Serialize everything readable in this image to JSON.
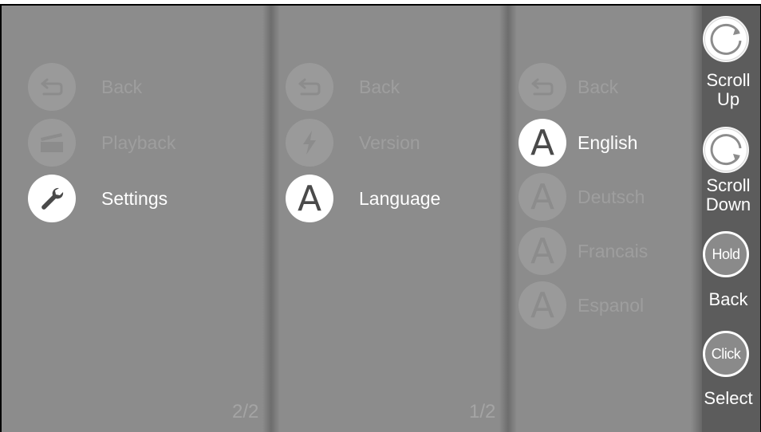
{
  "panels": {
    "main_menu": {
      "items": [
        {
          "label": "Back",
          "icon": "back-arrow-icon",
          "active": false
        },
        {
          "label": "Playback",
          "icon": "clapperboard-icon",
          "active": false
        },
        {
          "label": "Settings",
          "icon": "wrench-icon",
          "active": true
        }
      ],
      "page": "2/2"
    },
    "settings_menu": {
      "items": [
        {
          "label": "Back",
          "icon": "back-arrow-icon",
          "active": false
        },
        {
          "label": "Version",
          "icon": "lightning-icon",
          "active": false
        },
        {
          "label": "Language",
          "icon": "letter-a-icon",
          "icon_text": "A",
          "active": true
        }
      ],
      "page": "1/2"
    },
    "language_menu": {
      "items": [
        {
          "label": "Back",
          "icon": "back-arrow-icon",
          "active": false
        },
        {
          "label": "English",
          "icon": "letter-a-icon",
          "icon_text": "A",
          "active": true
        },
        {
          "label": "Deutsch",
          "icon": "letter-a-icon",
          "icon_text": "A",
          "active": false
        },
        {
          "label": "Francais",
          "icon": "letter-a-icon",
          "icon_text": "A",
          "active": false
        },
        {
          "label": "Espanol",
          "icon": "letter-a-icon",
          "icon_text": "A",
          "active": false
        }
      ]
    }
  },
  "controls": {
    "scroll_up": {
      "label_line1": "Scroll",
      "label_line2": "Up",
      "icon": "rotate-counterclockwise-icon"
    },
    "scroll_down": {
      "label_line1": "Scroll",
      "label_line2": "Down",
      "icon": "rotate-clockwise-icon"
    },
    "back": {
      "button_text": "Hold",
      "label": "Back"
    },
    "select": {
      "button_text": "Click",
      "label": "Select"
    }
  },
  "colors": {
    "background": "#8c8c8c",
    "inactive_icon": "#9a9a9a",
    "inactive_text": "#9e9e9e",
    "active": "#ffffff",
    "control_bar": "#5c5c5c"
  }
}
